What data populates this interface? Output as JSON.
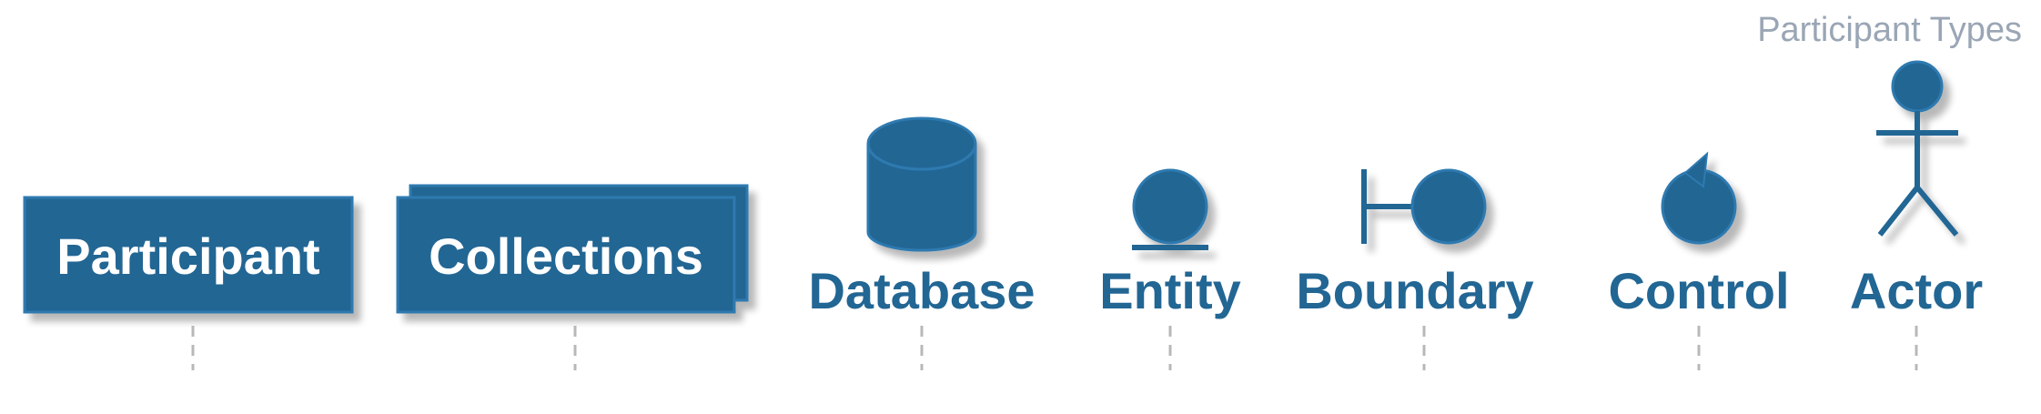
{
  "diagram_title": "Participant Types",
  "participants": [
    {
      "label": "Participant",
      "shape": "participant-box"
    },
    {
      "label": "Collections",
      "shape": "collections-stack"
    },
    {
      "label": "Database",
      "shape": "database-cylinder"
    },
    {
      "label": "Entity",
      "shape": "entity-circle"
    },
    {
      "label": "Boundary",
      "shape": "boundary-circle"
    },
    {
      "label": "Control",
      "shape": "control-circle"
    },
    {
      "label": "Actor",
      "shape": "actor-stickman"
    }
  ],
  "colors": {
    "fill": "#226694",
    "stroke": "#2f7ab0",
    "box_text": "#ffffff",
    "label_text": "#226694",
    "title_text": "#9aa6b5",
    "lifeline": "#b8b8b8",
    "shadow": "#d7d7d7"
  }
}
